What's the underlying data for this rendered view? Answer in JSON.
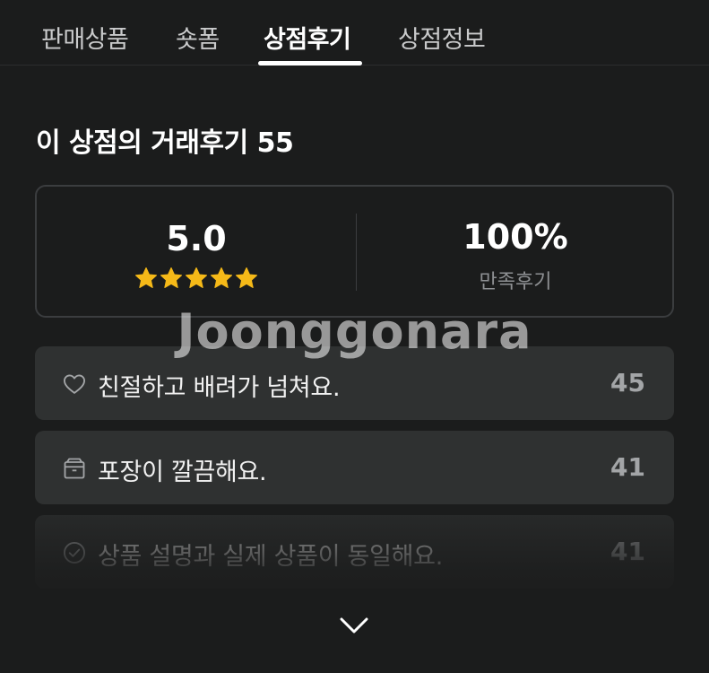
{
  "tabs": [
    {
      "label": "판매상품",
      "active": false
    },
    {
      "label": "숏폼",
      "active": false
    },
    {
      "label": "상점후기",
      "active": true
    },
    {
      "label": "상점정보",
      "active": false
    }
  ],
  "section_title": "이 상점의 거래후기 55",
  "summary": {
    "rating": "5.0",
    "stars": 5,
    "satisfaction_percent": "100%",
    "satisfaction_label": "만족후기"
  },
  "watermark": "Joonggonara",
  "review_tags": [
    {
      "icon": "heart-icon",
      "label": "친절하고 배려가 넘쳐요.",
      "count": "45"
    },
    {
      "icon": "box-icon",
      "label": "포장이 깔끔해요.",
      "count": "41"
    },
    {
      "icon": "check-circle-icon",
      "label": "상품 설명과 실제 상품이 동일해요.",
      "count": "41"
    }
  ],
  "colors": {
    "background": "#1b1c1c",
    "card": "#2f3131",
    "star": "#f5b918",
    "border": "#3b3d3f"
  },
  "expand_icon": "chevron-down-icon"
}
